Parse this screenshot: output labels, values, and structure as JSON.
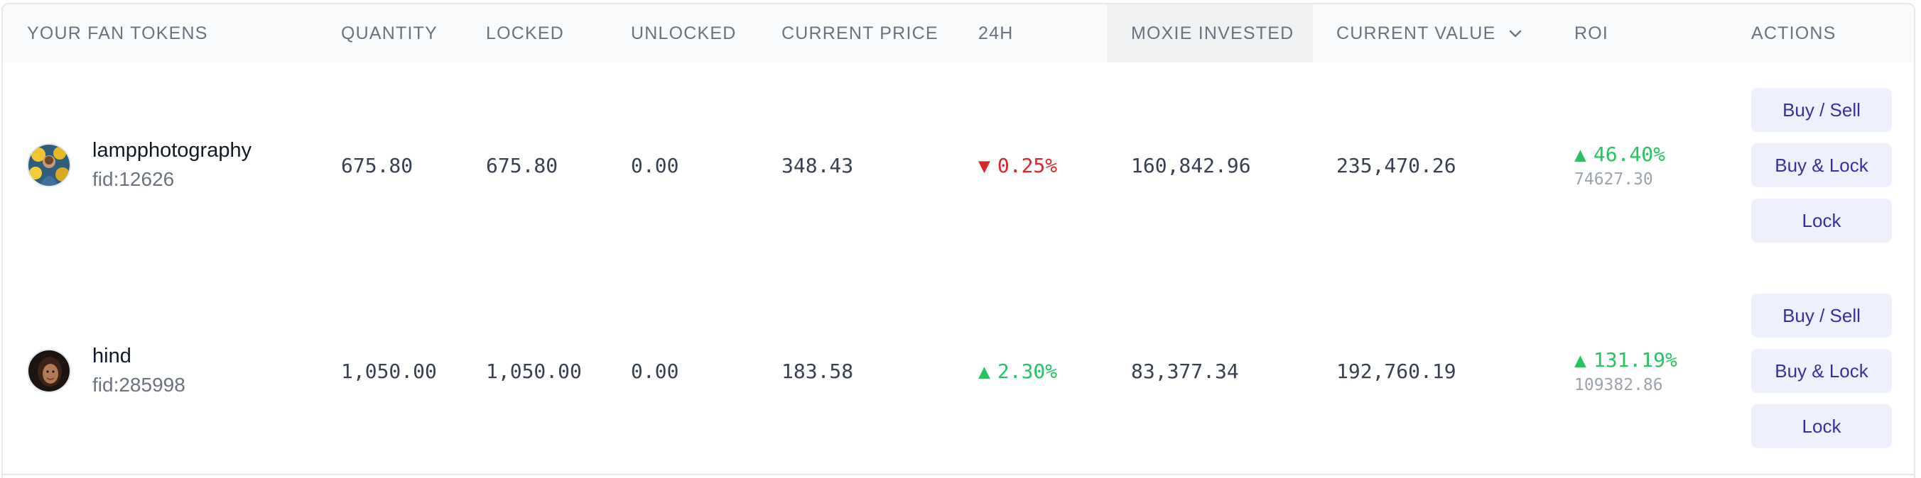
{
  "headers": {
    "token": "YOUR FAN TOKENS",
    "quantity": "QUANTITY",
    "locked": "LOCKED",
    "unlocked": "UNLOCKED",
    "current_price": "CURRENT PRICE",
    "change_24h": "24H",
    "moxie_invested": "MOXIE INVESTED",
    "current_value": "CURRENT VALUE",
    "roi": "ROI",
    "actions": "ACTIONS"
  },
  "icons": {
    "sort": "chevron-down-icon",
    "down": "triangle-down-icon",
    "up": "triangle-up-icon"
  },
  "colors": {
    "negative": "#dc2626",
    "positive": "#22c55e",
    "button_bg": "#eef0fd",
    "button_text": "#3730a3",
    "header_bg": "#f9fafb"
  },
  "rows": [
    {
      "username": "lampphotography",
      "fid": "fid:12626",
      "quantity": "675.80",
      "locked": "675.80",
      "unlocked": "0.00",
      "current_price": "348.43",
      "change_24h": "0.25%",
      "change_dir": "down",
      "change_arrow": "▼",
      "moxie_invested": "160,842.96",
      "current_value": "235,470.26",
      "roi_pct": "46.40%",
      "roi_arrow": "▲",
      "roi_abs": "74627.30",
      "buttons": {
        "buy_sell": "Buy / Sell",
        "buy_lock": "Buy & Lock",
        "lock": "Lock"
      }
    },
    {
      "username": "hind",
      "fid": "fid:285998",
      "quantity": "1,050.00",
      "locked": "1,050.00",
      "unlocked": "0.00",
      "current_price": "183.58",
      "change_24h": "2.30%",
      "change_dir": "up",
      "change_arrow": "▲",
      "moxie_invested": "83,377.34",
      "current_value": "192,760.19",
      "roi_pct": "131.19%",
      "roi_arrow": "▲",
      "roi_abs": "109382.86",
      "buttons": {
        "buy_sell": "Buy / Sell",
        "buy_lock": "Buy & Lock",
        "lock": "Lock"
      }
    }
  ]
}
